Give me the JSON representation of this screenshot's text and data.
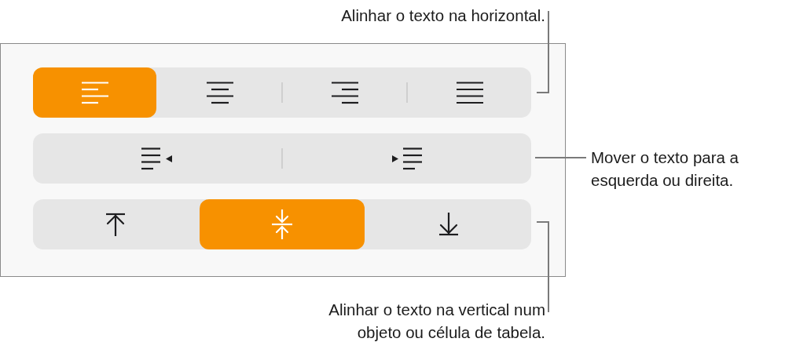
{
  "panel": {
    "groups": [
      {
        "buttons": [
          {
            "selected": true
          },
          {
            "selected": false
          },
          {
            "selected": false
          },
          {
            "selected": false
          }
        ]
      },
      {
        "buttons": [
          {
            "selected": false
          },
          {
            "selected": false
          }
        ]
      },
      {
        "buttons": [
          {
            "selected": false
          },
          {
            "selected": true
          },
          {
            "selected": false
          }
        ]
      }
    ]
  },
  "callouts": [
    {
      "lines": [
        "Alinhar o texto na horizontal."
      ]
    },
    {
      "lines": [
        "Mover o texto para a",
        "esquerda ou direita."
      ]
    },
    {
      "lines": [
        "Alinhar o texto na vertical num",
        "objeto ou célula de tabela."
      ]
    }
  ]
}
